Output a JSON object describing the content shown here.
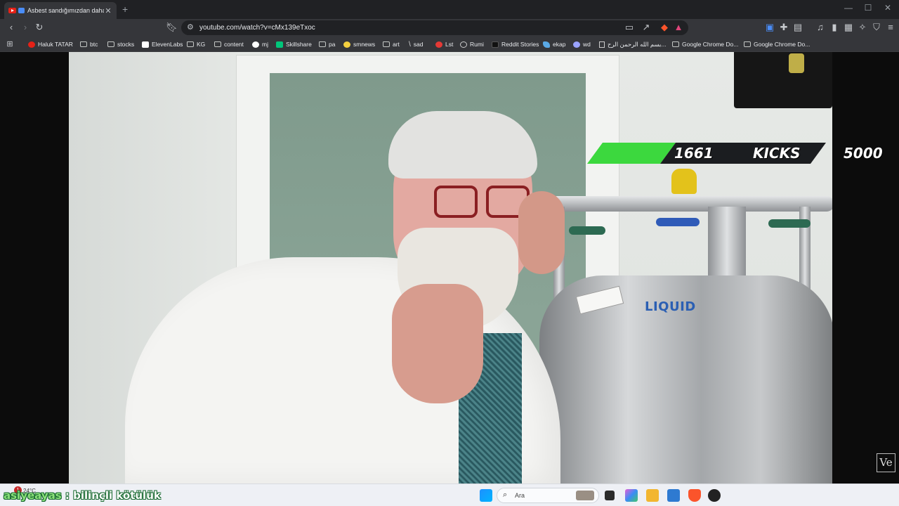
{
  "browser": {
    "tab_title": "Asbest sandığımızdan daha b",
    "tab_close": "✕",
    "new_tab": "+",
    "url": "youtube.com/watch?v=cMx139eTxoc",
    "window_controls": [
      "—",
      "☐",
      "✕"
    ]
  },
  "bookmarks": [
    {
      "label": "Haluk TATAR",
      "icon": "youtube-icon",
      "color": "#e62117"
    },
    {
      "label": "btc",
      "icon": "folder-icon"
    },
    {
      "label": "stocks",
      "icon": "folder-icon"
    },
    {
      "label": "ElevenLabs",
      "icon": "elevenlabs-icon",
      "color": "#ffffff"
    },
    {
      "label": "KG",
      "icon": "folder-icon"
    },
    {
      "label": "content",
      "icon": "folder-icon"
    },
    {
      "label": "mj",
      "icon": "github-icon",
      "color": "#ffffff"
    },
    {
      "label": "Skillshare",
      "icon": "skillshare-icon",
      "color": "#00c67a"
    },
    {
      "label": "pa",
      "icon": "folder-icon"
    },
    {
      "label": "smnews",
      "icon": "smile-icon",
      "color": "#f4d03f"
    },
    {
      "label": "art",
      "icon": "folder-icon"
    },
    {
      "label": "sad",
      "icon": "slash-icon",
      "color": "#dddddd"
    },
    {
      "label": "Lst",
      "icon": "s-icon",
      "color": "#e53935"
    },
    {
      "label": "Rumi",
      "icon": "globe-icon",
      "color": "#cccccc"
    },
    {
      "label": "Reddit Stories",
      "icon": "d-icon",
      "color": "#222222"
    },
    {
      "label": "ekap",
      "icon": "bird-icon",
      "color": "#5aa9e6"
    },
    {
      "label": "wd",
      "icon": "globe-icon",
      "color": "#9aa3ff"
    },
    {
      "label": "بسم الله الرحمن الرح...",
      "icon": "page-icon",
      "color": "#cccccc"
    },
    {
      "label": "Google Chrome Do...",
      "icon": "folder-icon"
    },
    {
      "label": "Google Chrome Do...",
      "icon": "folder-icon"
    }
  ],
  "video": {
    "kicks_count": "1661",
    "kicks_label": "KICKS",
    "kicks_goal": "5000",
    "tank_label": "LIQUID",
    "channel_logo": "Ve"
  },
  "chat_overlay": {
    "user": "asiyeayas",
    "separator": " : ",
    "message": "bilinçli kötülük"
  },
  "taskbar": {
    "weather_temp": "24°C",
    "notification_count": "1",
    "search_placeholder": "Ara"
  },
  "colors": {
    "kicks_green": "#3cd83e",
    "youtube_red": "#e62117",
    "chrome_dark": "#35363a"
  }
}
